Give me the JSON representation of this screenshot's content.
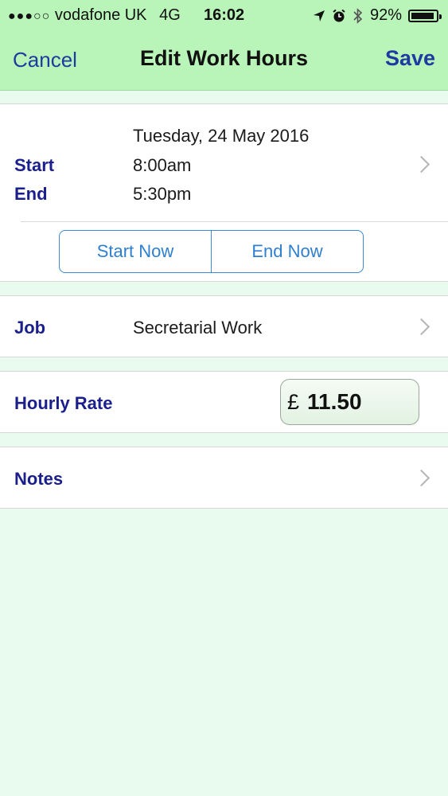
{
  "status_bar": {
    "signal": "●●●○○",
    "carrier": "vodafone UK",
    "network": "4G",
    "time": "16:02",
    "battery_text": "92%",
    "battery_level": 0.92,
    "icons": [
      "location-arrow-icon",
      "alarm-icon",
      "bluetooth-icon",
      "battery-icon"
    ]
  },
  "nav": {
    "cancel": "Cancel",
    "title": "Edit Work Hours",
    "save": "Save"
  },
  "time_section": {
    "date": "Tuesday, 24 May 2016",
    "start_label": "Start",
    "start_value": "8:00am",
    "end_label": "End",
    "end_value": "5:30pm",
    "start_now": "Start Now",
    "end_now": "End Now"
  },
  "job": {
    "label": "Job",
    "value": "Secretarial Work"
  },
  "rate": {
    "label": "Hourly Rate",
    "currency": "£",
    "amount": "11.50"
  },
  "notes": {
    "label": "Notes"
  },
  "colors": {
    "nav_bg": "#b9f4b9",
    "page_bg": "#e9fbee",
    "label": "#1a1f8c",
    "nav_link": "#1f3aa0",
    "button": "#2f7fd0"
  }
}
